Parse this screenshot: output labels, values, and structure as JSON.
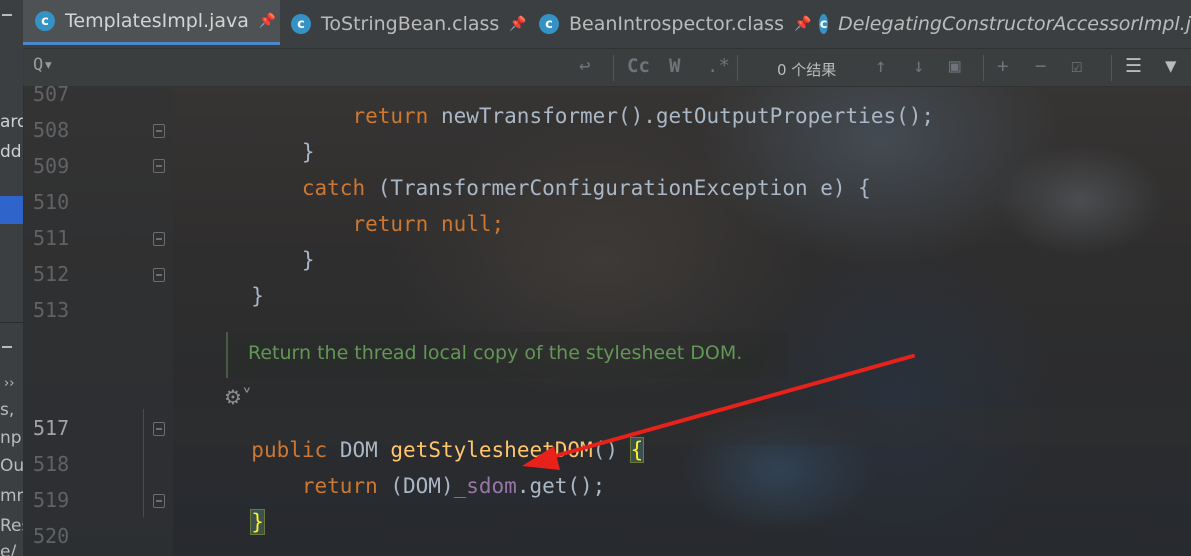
{
  "tabs": [
    {
      "label": "TemplatesImpl.java",
      "icon": "class-icon",
      "pinned": true,
      "active": true
    },
    {
      "label": "ToStringBean.class",
      "icon": "class-icon",
      "pinned": true,
      "active": false
    },
    {
      "label": "BeanIntrospector.class",
      "icon": "class-icon",
      "pinned": true,
      "active": false
    },
    {
      "label": "DelegatingConstructorAccessorImpl.j",
      "icon": "class-icon",
      "pinned": false,
      "active": false
    }
  ],
  "find": {
    "search_icon_glyph": "Q▾",
    "match_case": "Cc",
    "words": "W",
    "regex": ".*",
    "result_text": "0 个结果"
  },
  "left_fragments": [
    "aro",
    "dd",
    "››",
    "s,",
    "npu",
    "Out",
    "mm",
    "Res",
    "e/"
  ],
  "lines": [
    {
      "num": "507",
      "tokens": [
        [
          "kw",
          "        return "
        ],
        [
          "plain",
          "newTransformer().getOutputProperties();"
        ]
      ]
    },
    {
      "num": "508",
      "tokens": [
        [
          "plain",
          "    }"
        ]
      ]
    },
    {
      "num": "509",
      "tokens": [
        [
          "kw",
          "    catch "
        ],
        [
          "plain",
          "(TransformerConfigurationException e) {"
        ]
      ]
    },
    {
      "num": "510",
      "tokens": [
        [
          "kw",
          "        return null"
        ],
        [
          "plain",
          ";"
        ]
      ]
    },
    {
      "num": "511",
      "tokens": [
        [
          "plain",
          "    }"
        ]
      ]
    },
    {
      "num": "512",
      "tokens": [
        [
          "plain",
          "}"
        ]
      ]
    },
    {
      "num": "513",
      "tokens": []
    },
    {
      "num": "517",
      "tokens": [
        [
          "kw",
          "public "
        ],
        [
          "plain",
          "DOM "
        ],
        [
          "fn",
          "getStylesheetDOM"
        ],
        [
          "plain",
          "() "
        ],
        [
          "brace",
          "{"
        ]
      ]
    },
    {
      "num": "518",
      "tokens": [
        [
          "kw",
          "    return "
        ],
        [
          "plain",
          "(DOM)"
        ],
        [
          "fld",
          "_sdom"
        ],
        [
          "plain",
          ".get();"
        ]
      ]
    },
    {
      "num": "519",
      "tokens": [
        [
          "brace",
          "}"
        ]
      ]
    },
    {
      "num": "520",
      "tokens": []
    }
  ],
  "doc_comment": "Return the thread local copy of the stylesheet DOM.",
  "colors": {
    "keyword": "#cc7832",
    "function": "#ffc66d",
    "field": "#9876aa",
    "doc": "#629755",
    "arrow": "#e8221a"
  }
}
